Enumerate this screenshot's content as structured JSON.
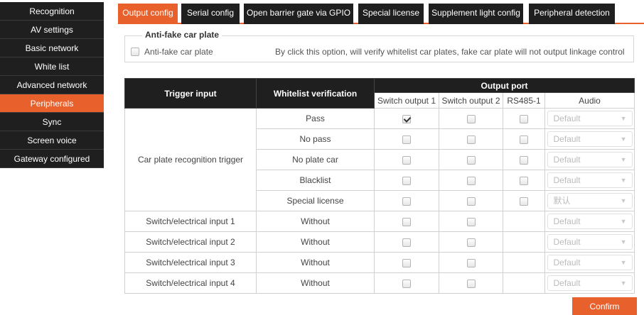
{
  "sidebar": {
    "items": [
      {
        "label": "Recognition"
      },
      {
        "label": "AV settings"
      },
      {
        "label": "Basic network"
      },
      {
        "label": "White list"
      },
      {
        "label": "Advanced network"
      },
      {
        "label": "Peripherals",
        "active": true
      },
      {
        "label": "Sync"
      },
      {
        "label": "Screen voice"
      },
      {
        "label": "Gateway configured"
      }
    ]
  },
  "tabs": [
    {
      "label": "Output config",
      "active": true
    },
    {
      "label": "Serial config"
    },
    {
      "label": "Open barrier gate via GPIO"
    },
    {
      "label": "Special license"
    },
    {
      "label": "Supplement light config"
    },
    {
      "label": "Peripheral detection"
    }
  ],
  "anti_fake": {
    "legend": "Anti-fake car plate",
    "checkbox_label": "Anti-fake car plate",
    "checked": false,
    "description": "By click this option, will verify whitelist car plates, fake car plate will not output linkage control"
  },
  "table": {
    "headers": {
      "trigger_input": "Trigger input",
      "whitelist_verification": "Whitelist verification",
      "output_port": "Output port",
      "switch_output_1": "Switch output 1",
      "switch_output_2": "Switch output 2",
      "rs485_1": "RS485-1",
      "audio": "Audio"
    },
    "car_plate_group": "Car plate recognition trigger",
    "rows": [
      {
        "verification": "Pass",
        "sw1": true,
        "sw2": false,
        "rs485": false,
        "audio": "Default"
      },
      {
        "verification": "No pass",
        "sw1": false,
        "sw2": false,
        "rs485": false,
        "audio": "Default"
      },
      {
        "verification": "No plate car",
        "sw1": false,
        "sw2": false,
        "rs485": false,
        "audio": "Default"
      },
      {
        "verification": "Blacklist",
        "sw1": false,
        "sw2": false,
        "rs485": false,
        "audio": "Default"
      },
      {
        "verification": "Special license",
        "sw1": false,
        "sw2": false,
        "rs485": false,
        "audio": "默认"
      }
    ],
    "switch_rows": [
      {
        "trigger": "Switch/electrical input 1",
        "verification": "Without",
        "sw1": false,
        "sw2": false,
        "audio": "Default"
      },
      {
        "trigger": "Switch/electrical input 2",
        "verification": "Without",
        "sw1": false,
        "sw2": false,
        "audio": "Default"
      },
      {
        "trigger": "Switch/electrical input 3",
        "verification": "Without",
        "sw1": false,
        "sw2": false,
        "audio": "Default"
      },
      {
        "trigger": "Switch/electrical input 4",
        "verification": "Without",
        "sw1": false,
        "sw2": false,
        "audio": "Default"
      }
    ]
  },
  "confirm_label": "Confirm",
  "colors": {
    "accent": "#e8612c",
    "dark": "#1f1f1f"
  }
}
